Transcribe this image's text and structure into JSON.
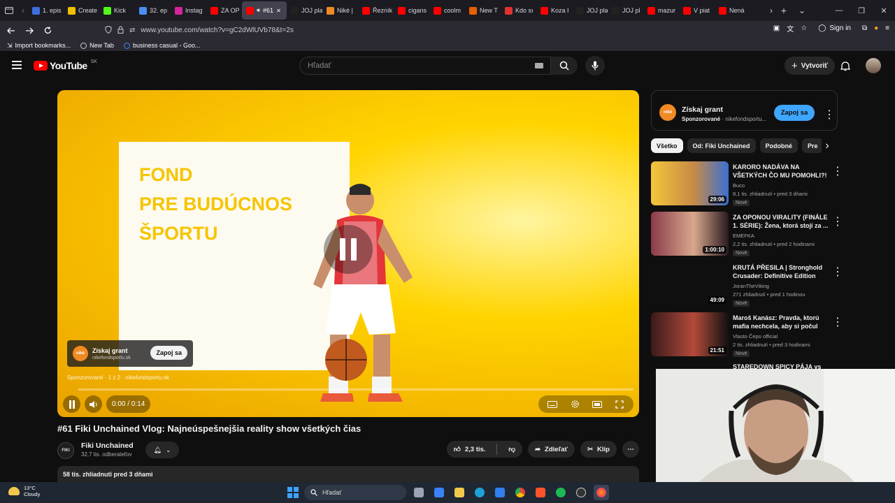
{
  "browser": {
    "tabs": [
      {
        "label": "1. epis",
        "color": "#3d6ee0"
      },
      {
        "label": "Create",
        "color": "#f0c000"
      },
      {
        "label": "Kick",
        "color": "#53fc18"
      },
      {
        "label": "32. ep",
        "color": "#4a8ef0"
      },
      {
        "label": "Instag",
        "color": "#d6249f"
      },
      {
        "label": "ZA OP",
        "color": "#ff0000"
      },
      {
        "label": "#61",
        "color": "#ff0000",
        "active": true
      },
      {
        "label": "JOJ play",
        "color": "#222222"
      },
      {
        "label": "Niké |",
        "color": "#f08a24"
      },
      {
        "label": "Řezník",
        "color": "#ff0000"
      },
      {
        "label": "cigans",
        "color": "#ff0000"
      },
      {
        "label": "coolm",
        "color": "#ff0000"
      },
      {
        "label": "New T",
        "color": "#e66000"
      },
      {
        "label": "Kdo sı",
        "color": "#e03131"
      },
      {
        "label": "Koza I",
        "color": "#ff0000"
      },
      {
        "label": "JOJ play",
        "color": "#222222"
      },
      {
        "label": "JOJ pl",
        "color": "#222222"
      },
      {
        "label": "mazur",
        "color": "#ff0000"
      },
      {
        "label": "V piat",
        "color": "#ff0000"
      },
      {
        "label": "Nená",
        "color": "#ff0000"
      }
    ],
    "url": "www.youtube.com/watch?v=gC2dWlUVb78&t=2s",
    "signin_label": "Sign in",
    "bookmarks": [
      "Import bookmarks...",
      "New Tab",
      "business casual - Goo..."
    ]
  },
  "header": {
    "logo_text": "YouTube",
    "region": "SK",
    "search_placeholder": "Hľadať",
    "create_label": "Vytvoriť"
  },
  "player": {
    "promo_lines": [
      "FOND",
      "PRE BUDÚCNOS",
      "ŠPORTU"
    ],
    "ad_title": "Získaj grant",
    "ad_domain": "nikefondsportu.sk",
    "ad_cta": "Zapoj sa",
    "ad_logo": "niké",
    "sponsored_line": "Sponzorované · 1 z 2 · nikefondsportu.sk",
    "time": "0:00 / 0:14",
    "progress": 0.0
  },
  "video": {
    "title": "#61 Fiki Unchained Vlog: Najneúspešnejšia reality show všetkých čias",
    "channel": "Fiki Unchained",
    "channel_avatar": "FIKI",
    "subscribers": "32,7 tis. odberateľov",
    "likes": "2,3 tis.",
    "share_label": "Zdieľať",
    "clip_label": "Klip",
    "description_meta": "58 tis. zhliadnutí  pred 3 dňami"
  },
  "sidebar": {
    "ad": {
      "title": "Získaj grant",
      "sponsored": "Sponzorované",
      "domain": "nikefondsportu...",
      "cta": "Zapoj sa",
      "logo": "niké"
    },
    "chips": [
      "Všetko",
      "Od: Fiki Unchained",
      "Podobné",
      "Pre"
    ],
    "recommendations": [
      {
        "title": "KARORO NADÁVA NA VŠETKÝCH ČO MU POMOHLI?!",
        "channel": "Buco",
        "meta": "8,1 tis. zhliadnutí • pred 3 dňami",
        "badge": "Nové",
        "duration": "29:06",
        "thumb_colors": [
          "#f3c63a",
          "#c88a47",
          "#3b6fd1"
        ]
      },
      {
        "title": "ZA OPONOU VIRALITY (FINÁLE 1. SÉRIE): Žena, ktorá stojí za ...",
        "channel": "EMEFKA",
        "meta": "2,2 tis. zhliadnutí • pred 2 hodinami",
        "badge": "Nové",
        "duration": "1:00:10",
        "thumb_colors": [
          "#8a3a4a",
          "#d9a88c",
          "#2a1a20"
        ]
      },
      {
        "title": "KRUTÁ PŘESILA | Stronghold Crusader: Definitive Edition #3...",
        "channel": "JoranTheViking",
        "meta": "271 zhliadnutí • pred 1 hodinou",
        "badge": "Nové",
        "duration": "49:09",
        "thumb_colors": [
          "#0f0f0f",
          "#0f0f0f",
          "#0f0f0f"
        ]
      },
      {
        "title": "Maroš Kanász: Pravda, ktorú mafia nechcela, aby si počul",
        "channel": "Vlasto Čepo official",
        "meta": "2 tis. zhliadnutí • pred 3 hodinami",
        "badge": "Nové",
        "duration": "21:51",
        "thumb_colors": [
          "#3a1a1a",
          "#b34a3a",
          "#111111"
        ]
      }
    ],
    "cut_title": "STAREDOWN SPICY PÁJA vs"
  },
  "taskbar": {
    "temperature": "13°C",
    "weather": "Cloudy",
    "search_label": "Hľadať"
  }
}
